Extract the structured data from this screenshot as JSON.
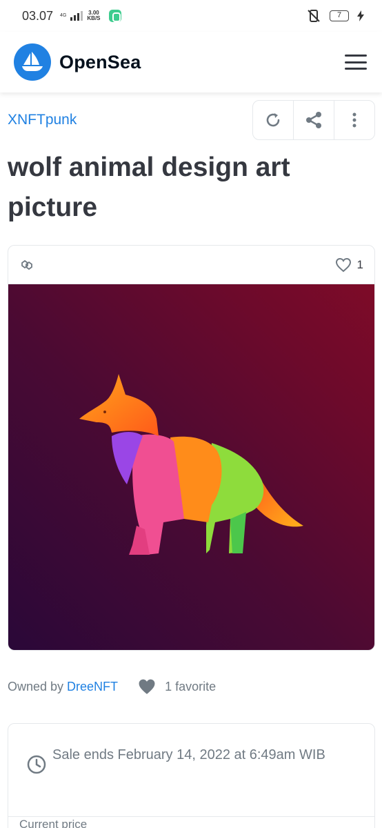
{
  "status_bar": {
    "time": "03.07",
    "network": "4G",
    "speed_value": "3.00",
    "speed_unit": "KB/S",
    "battery": "7"
  },
  "header": {
    "brand": "OpenSea"
  },
  "item": {
    "collection": "XNFTpunk",
    "title": "wolf animal design art picture",
    "favorite_count": "1",
    "owned_by_label": "Owned by",
    "owner": "DreeNFT",
    "favorites_text": "1 favorite"
  },
  "sale": {
    "ends_text": "Sale ends February 14, 2022 at 6:49am WIB",
    "price_label": "Current price"
  },
  "icons": {
    "logo": "opensea-boat-icon",
    "menu": "hamburger-menu-icon",
    "refresh": "refresh-icon",
    "share": "share-icon",
    "more": "more-vertical-icon",
    "chain": "polygon-chain-icon",
    "heart": "heart-icon",
    "clock": "clock-icon"
  },
  "colors": {
    "accent": "#2081e2",
    "text": "#353840",
    "muted": "#707a83",
    "border": "#e5e8eb"
  }
}
